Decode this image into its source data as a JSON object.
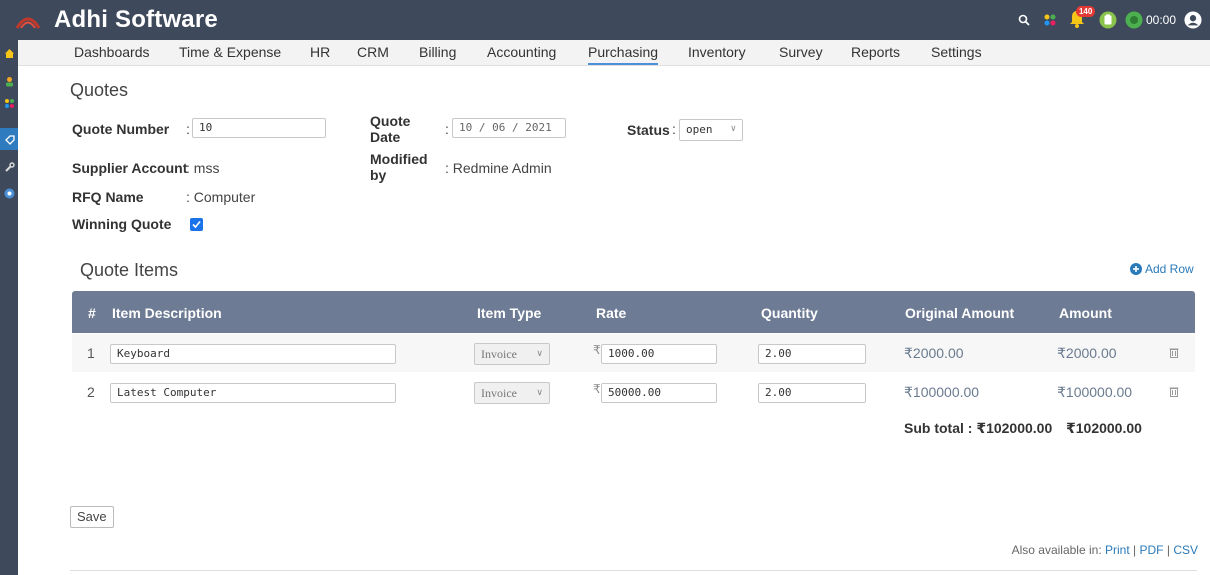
{
  "app": {
    "title": "Adhi Software"
  },
  "header": {
    "notification_count": "140",
    "timer": "00:00"
  },
  "nav": [
    {
      "label": "Dashboards"
    },
    {
      "label": "Time & Expense"
    },
    {
      "label": "HR"
    },
    {
      "label": "CRM"
    },
    {
      "label": "Billing"
    },
    {
      "label": "Accounting"
    },
    {
      "label": "Purchasing"
    },
    {
      "label": "Inventory"
    },
    {
      "label": "Survey"
    },
    {
      "label": "Reports"
    },
    {
      "label": "Settings"
    }
  ],
  "nav_active": "Purchasing",
  "page": {
    "title": "Quotes"
  },
  "form": {
    "quote_number_label": "Quote Number",
    "quote_number_value": "10",
    "quote_date_label": "Quote Date",
    "quote_date_value": "10 / 06 / 2021",
    "status_label": "Status",
    "status_value": "open",
    "supplier_label": "Supplier Account",
    "supplier_value": ": mss",
    "modified_label": "Modified by",
    "modified_value": ": Redmine Admin",
    "rfq_label": "RFQ Name",
    "rfq_value": ": Computer",
    "winning_label": "Winning Quote",
    "colon": ":"
  },
  "items": {
    "title": "Quote Items",
    "add_row": "Add Row",
    "columns": {
      "num": "#",
      "description": "Item Description",
      "type": "Item Type",
      "rate": "Rate",
      "quantity": "Quantity",
      "original_amount": "Original Amount",
      "amount": "Amount"
    },
    "rows": [
      {
        "num": "1",
        "description": "Keyboard",
        "type": "Invoice",
        "rate": "1000.00",
        "quantity": "2.00",
        "original_amount": "₹2000.00",
        "amount": "₹2000.00"
      },
      {
        "num": "2",
        "description": "Latest Computer",
        "type": "Invoice",
        "rate": "50000.00",
        "quantity": "2.00",
        "original_amount": "₹100000.00",
        "amount": "₹100000.00"
      }
    ],
    "subtotal_label": "Sub total : ₹102000.00",
    "subtotal_amount": "₹102000.00",
    "currency_symbol": "₹"
  },
  "footer": {
    "save": "Save",
    "also_available": "Also available in:",
    "print": "Print",
    "pdf": "PDF",
    "csv": "CSV",
    "sep": "|"
  },
  "colors": {
    "header_bg": "#3e4a5c",
    "table_header": "#6d7b94",
    "accent": "#4a90d9",
    "link": "#2a7ab8"
  }
}
